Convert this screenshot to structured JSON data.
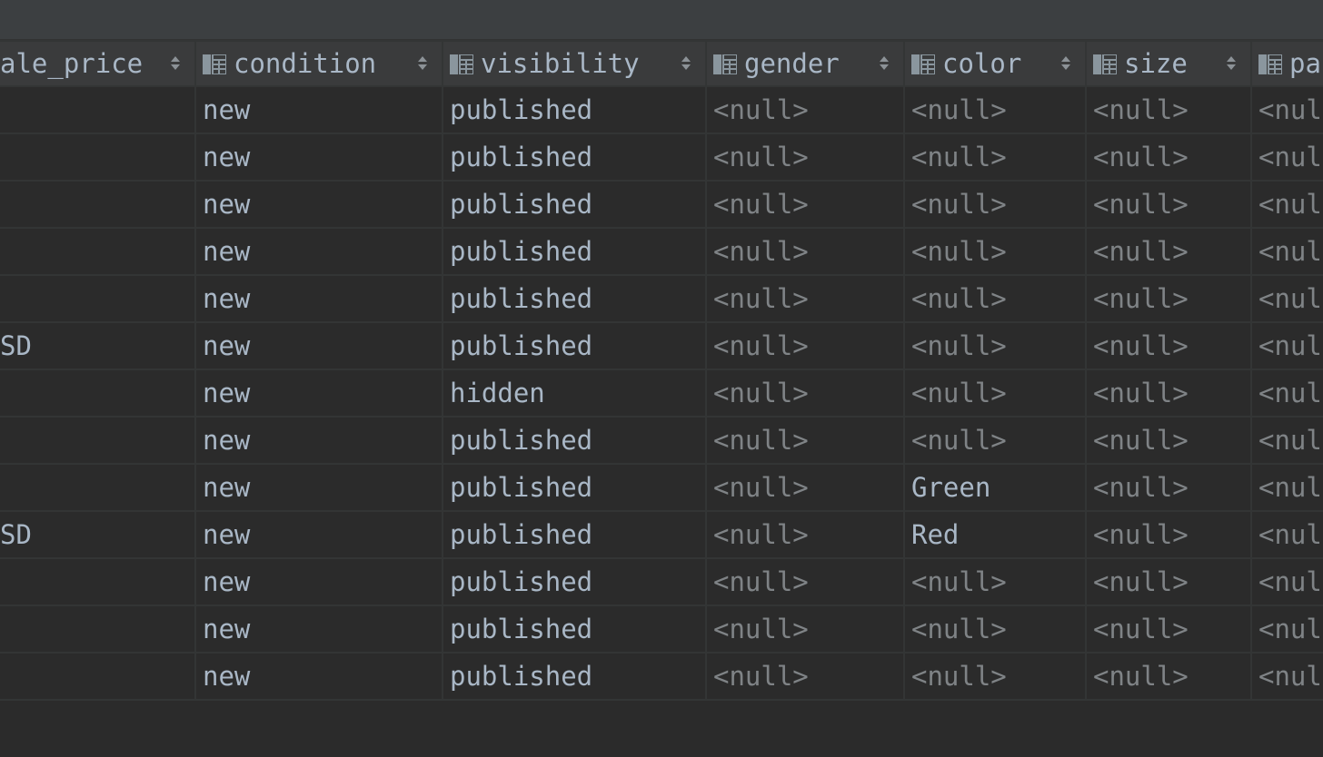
{
  "columns": [
    {
      "name": "ale_price",
      "icon": "table-column-icon",
      "partial": true
    },
    {
      "name": "condition",
      "icon": "table-column-icon"
    },
    {
      "name": "visibility",
      "icon": "table-column-icon"
    },
    {
      "name": "gender",
      "icon": "table-column-icon"
    },
    {
      "name": "color",
      "icon": "table-column-icon"
    },
    {
      "name": "size",
      "icon": "table-column-icon"
    },
    {
      "name": "pa",
      "icon": "table-column-icon",
      "partial": true
    }
  ],
  "rows": [
    [
      "",
      "new",
      "published",
      "<null>",
      "<null>",
      "<null>",
      "<nul"
    ],
    [
      "",
      "new",
      "published",
      "<null>",
      "<null>",
      "<null>",
      "<nul"
    ],
    [
      "",
      "new",
      "published",
      "<null>",
      "<null>",
      "<null>",
      "<nul"
    ],
    [
      "",
      "new",
      "published",
      "<null>",
      "<null>",
      "<null>",
      "<nul"
    ],
    [
      "",
      "new",
      "published",
      "<null>",
      "<null>",
      "<null>",
      "<nul"
    ],
    [
      "SD",
      "new",
      "published",
      "<null>",
      "<null>",
      "<null>",
      "<nul"
    ],
    [
      "",
      "new",
      "hidden",
      "<null>",
      "<null>",
      "<null>",
      "<nul"
    ],
    [
      "",
      "new",
      "published",
      "<null>",
      "<null>",
      "<null>",
      "<nul"
    ],
    [
      "",
      "new",
      "published",
      "<null>",
      "Green",
      "<null>",
      "<nul"
    ],
    [
      "SD",
      "new",
      "published",
      "<null>",
      "Red",
      "<null>",
      "<nul"
    ],
    [
      "",
      "new",
      "published",
      "<null>",
      "<null>",
      "<null>",
      "<nul"
    ],
    [
      "",
      "new",
      "published",
      "<null>",
      "<null>",
      "<null>",
      "<nul"
    ],
    [
      "",
      "new",
      "published",
      "<null>",
      "<null>",
      "<null>",
      "<nul"
    ]
  ],
  "colors": {
    "background": "#2b2b2b",
    "header": "#3a3b3c",
    "text": "#a9b7c6",
    "null_text": "#7f8386"
  }
}
